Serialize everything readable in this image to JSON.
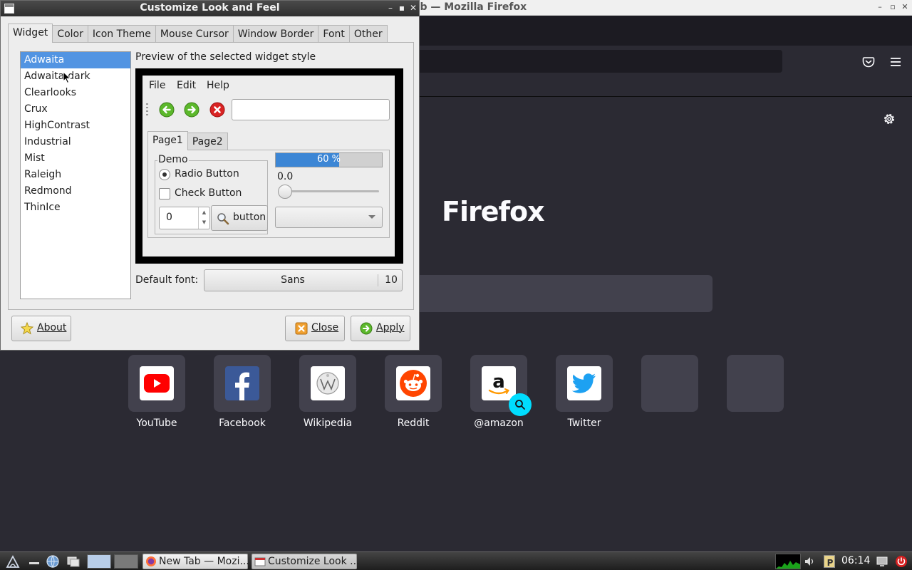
{
  "firefox": {
    "window_title": "New Tab — Mozilla Firefox",
    "visible_title": "ab — Mozilla Firefox",
    "wordmark": "Firefox",
    "top_sites": [
      {
        "label": "YouTube",
        "icon": "youtube-icon"
      },
      {
        "label": "Facebook",
        "icon": "facebook-icon"
      },
      {
        "label": "Wikipedia",
        "icon": "wikipedia-icon"
      },
      {
        "label": "Reddit",
        "icon": "reddit-icon"
      },
      {
        "label": "@amazon",
        "icon": "amazon-icon"
      },
      {
        "label": "Twitter",
        "icon": "twitter-icon"
      }
    ],
    "colors": {
      "background": "#2b2a33",
      "tile": "#42414d",
      "accent": "#00ddff"
    }
  },
  "dialog": {
    "title": "Customize Look and Feel",
    "tabs": [
      "Widget",
      "Color",
      "Icon Theme",
      "Mouse Cursor",
      "Window Border",
      "Font",
      "Other"
    ],
    "active_tab": "Widget",
    "themes": [
      "Adwaita",
      "Adwaita-dark",
      "Clearlooks",
      "Crux",
      "HighContrast",
      "Industrial",
      "Mist",
      "Raleigh",
      "Redmond",
      "ThinIce"
    ],
    "selected_theme": "Adwaita",
    "preview": {
      "label": "Preview of the selected widget style",
      "menus": [
        "File",
        "Edit",
        "Help"
      ],
      "toolbar_icons": [
        "back-icon",
        "forward-icon",
        "stop-icon"
      ],
      "notebook_tabs": [
        "Page1",
        "Page2"
      ],
      "frame_label": "Demo",
      "radio_label": "Radio Button",
      "check_label": "Check Button",
      "spin_value": "0",
      "button_label": "button",
      "progress_text": "60 %",
      "progress_fraction": 0.6,
      "scale_value": "0.0"
    },
    "default_font_label": "Default font:",
    "font_name": "Sans",
    "font_size": "10",
    "buttons": {
      "about": "About",
      "close": "Close",
      "apply": "Apply"
    },
    "colors": {
      "selection": "#5294e2",
      "progress": "#3c86d5"
    }
  },
  "taskbar": {
    "tasks": [
      "New Tab — Mozi...",
      "Customize Look ..."
    ],
    "clock": "06:14"
  }
}
